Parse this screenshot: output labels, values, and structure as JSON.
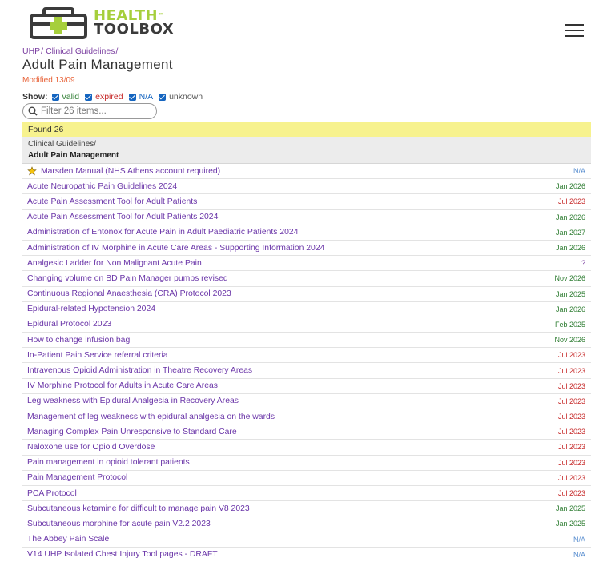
{
  "header": {
    "logo_line1": "HEALTH",
    "logo_line2": "TOOLBOX",
    "logo_tm": "™"
  },
  "breadcrumb": [
    "UHP",
    "Clinical Guidelines"
  ],
  "page_title": "Adult Pain Management",
  "modified": "Modified 13/09",
  "show": {
    "label": "Show:",
    "options": [
      "valid",
      "expired",
      "N/A",
      "unknown"
    ]
  },
  "filter": {
    "placeholder": "Filter 26 items..."
  },
  "found": "Found 26",
  "group": {
    "path": "Clinical Guidelines/",
    "name": "Adult Pain Management"
  },
  "colors": {
    "valid": "#2e7d32",
    "expired": "#c62828",
    "na": "#5a8fd0",
    "unknown": "#7a3ea0",
    "found_bg": "#f7f28e",
    "brand_green": "#a6cf3c"
  },
  "items": [
    {
      "title": "Marsden Manual (NHS Athens account required)",
      "status": "N/A",
      "state": "na",
      "starred": true
    },
    {
      "title": "Acute Neuropathic Pain Guidelines 2024",
      "status": "Jan 2026",
      "state": "valid"
    },
    {
      "title": "Acute Pain Assessment Tool for Adult Patients",
      "status": "Jul 2023",
      "state": "expired"
    },
    {
      "title": "Acute Pain Assessment Tool for Adult Patients 2024",
      "status": "Jan 2026",
      "state": "valid"
    },
    {
      "title": "Administration of Entonox for Acute Pain in Adult Paediatric Patients 2024",
      "status": "Jan 2027",
      "state": "valid"
    },
    {
      "title": "Administration of IV Morphine in Acute Care Areas - Supporting Information 2024",
      "status": "Jan 2026",
      "state": "valid"
    },
    {
      "title": "Analgesic Ladder for Non Malignant Acute Pain",
      "status": "?",
      "state": "unknown"
    },
    {
      "title": "Changing volume on BD Pain Manager pumps revised",
      "status": "Nov 2026",
      "state": "valid"
    },
    {
      "title": "Continuous Regional Anaesthesia (CRA) Protocol 2023",
      "status": "Jan 2025",
      "state": "valid"
    },
    {
      "title": "Epidural-related Hypotension 2024",
      "status": "Jan 2026",
      "state": "valid"
    },
    {
      "title": "Epidural Protocol 2023",
      "status": "Feb 2025",
      "state": "valid"
    },
    {
      "title": "How to change infusion bag",
      "status": "Nov 2026",
      "state": "valid"
    },
    {
      "title": "In-Patient Pain Service referral criteria",
      "status": "Jul 2023",
      "state": "expired"
    },
    {
      "title": "Intravenous Opioid Administration in Theatre Recovery Areas",
      "status": "Jul 2023",
      "state": "expired"
    },
    {
      "title": "IV Morphine Protocol for Adults in Acute Care Areas",
      "status": "Jul 2023",
      "state": "expired"
    },
    {
      "title": "Leg weakness with Epidural Analgesia in Recovery Areas",
      "status": "Jul 2023",
      "state": "expired"
    },
    {
      "title": "Management of leg weakness with epidural analgesia on the wards",
      "status": "Jul 2023",
      "state": "expired"
    },
    {
      "title": "Managing Complex Pain Unresponsive to Standard Care",
      "status": "Jul 2023",
      "state": "expired"
    },
    {
      "title": "Naloxone use for Opioid Overdose",
      "status": "Jul 2023",
      "state": "expired"
    },
    {
      "title": "Pain management in opioid tolerant patients",
      "status": "Jul 2023",
      "state": "expired"
    },
    {
      "title": "Pain Management Protocol",
      "status": "Jul 2023",
      "state": "expired"
    },
    {
      "title": "PCA Protocol",
      "status": "Jul 2023",
      "state": "expired"
    },
    {
      "title": "Subcutaneous ketamine for difficult to manage pain V8 2023",
      "status": "Jan 2025",
      "state": "valid"
    },
    {
      "title": "Subcutaneous morphine for acute pain V2.2 2023",
      "status": "Jan 2025",
      "state": "valid"
    },
    {
      "title": "The Abbey Pain Scale",
      "status": "N/A",
      "state": "na"
    },
    {
      "title": "V14 UHP Isolated Chest Injury Tool pages - DRAFT",
      "status": "N/A",
      "state": "na"
    }
  ]
}
